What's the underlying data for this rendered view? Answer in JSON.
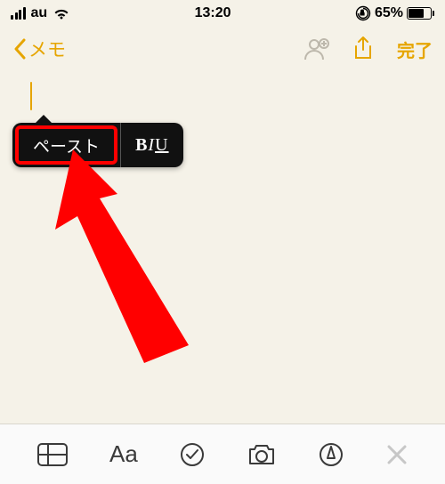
{
  "status_bar": {
    "carrier": "au",
    "time": "13:20",
    "battery_percent": "65%"
  },
  "nav": {
    "back_label": "メモ",
    "done_label": "完了"
  },
  "edit_menu": {
    "paste_label": "ペースト",
    "format_b": "B",
    "format_i": "I",
    "format_u": "U"
  },
  "toolbar": {
    "text_format_label": "Aa"
  },
  "icons": {
    "signal": "signal-icon",
    "wifi": "wifi-icon",
    "orientation_lock": "orientation-lock-icon",
    "battery": "battery-icon",
    "back_chevron": "chevron-left-icon",
    "add_person": "add-person-icon",
    "share": "share-icon",
    "table": "table-icon",
    "checklist": "checklist-icon",
    "camera": "camera-icon",
    "markup": "markup-icon",
    "close": "close-icon"
  }
}
